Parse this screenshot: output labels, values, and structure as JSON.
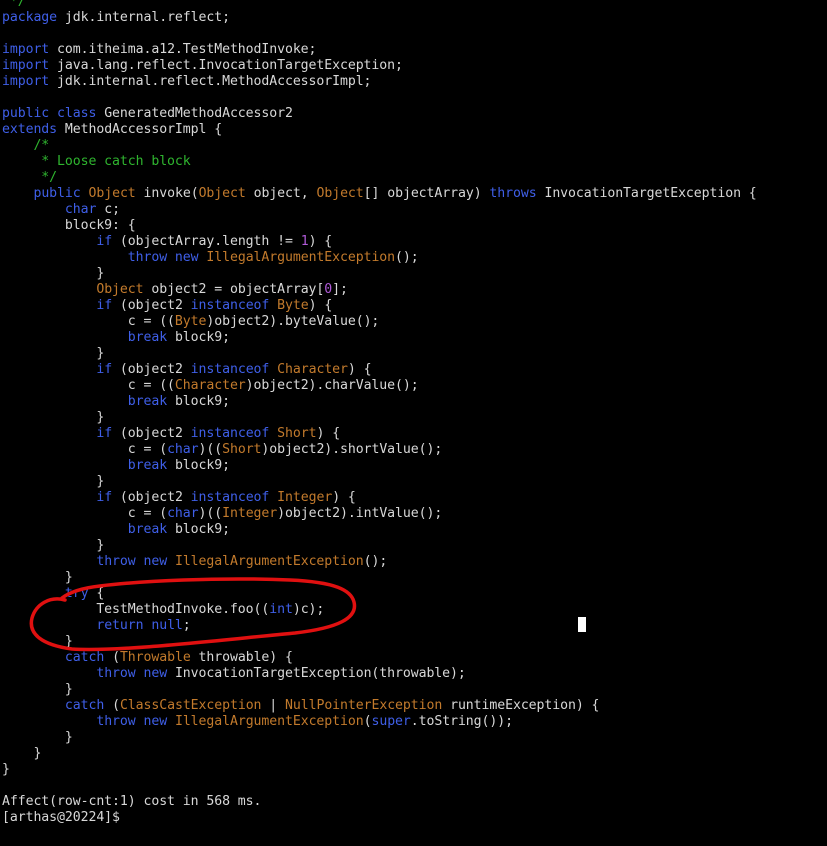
{
  "terminal": {
    "background": "#000000",
    "colors": {
      "text": "#d8d8d8",
      "keyword": "#3f5fe8",
      "type": "#c27a2c",
      "number": "#b05ad8",
      "comment": "#2fb52f",
      "annotation": "#e01010",
      "cursor": "#ffffff"
    },
    "lines": [
      [
        {
          "t": "c",
          "s": " */"
        }
      ],
      [
        {
          "t": "k",
          "s": "package"
        },
        {
          "t": "x",
          "s": " jdk.internal.reflect;"
        }
      ],
      [],
      [
        {
          "t": "k",
          "s": "import"
        },
        {
          "t": "x",
          "s": " com.itheima.a12.TestMethodInvoke;"
        }
      ],
      [
        {
          "t": "k",
          "s": "import"
        },
        {
          "t": "x",
          "s": " java.lang.reflect.InvocationTargetException;"
        }
      ],
      [
        {
          "t": "k",
          "s": "import"
        },
        {
          "t": "x",
          "s": " jdk.internal.reflect.MethodAccessorImpl;"
        }
      ],
      [],
      [
        {
          "t": "k",
          "s": "public class"
        },
        {
          "t": "x",
          "s": " GeneratedMethodAccessor2"
        }
      ],
      [
        {
          "t": "k",
          "s": "extends"
        },
        {
          "t": "x",
          "s": " MethodAccessorImpl {"
        }
      ],
      [
        {
          "t": "c",
          "s": "    /*"
        }
      ],
      [
        {
          "t": "c",
          "s": "     * Loose catch block"
        }
      ],
      [
        {
          "t": "c",
          "s": "     */"
        }
      ],
      [
        {
          "t": "x",
          "s": "    "
        },
        {
          "t": "k",
          "s": "public"
        },
        {
          "t": "x",
          "s": " "
        },
        {
          "t": "y",
          "s": "Object"
        },
        {
          "t": "x",
          "s": " invoke("
        },
        {
          "t": "y",
          "s": "Object"
        },
        {
          "t": "x",
          "s": " object, "
        },
        {
          "t": "y",
          "s": "Object"
        },
        {
          "t": "x",
          "s": "[] objectArray) "
        },
        {
          "t": "k",
          "s": "throws"
        },
        {
          "t": "x",
          "s": " InvocationTargetException {"
        }
      ],
      [
        {
          "t": "x",
          "s": "        "
        },
        {
          "t": "k",
          "s": "char"
        },
        {
          "t": "x",
          "s": " c;"
        }
      ],
      [
        {
          "t": "x",
          "s": "        block9: {"
        }
      ],
      [
        {
          "t": "x",
          "s": "            "
        },
        {
          "t": "k",
          "s": "if"
        },
        {
          "t": "x",
          "s": " (objectArray.length != "
        },
        {
          "t": "n",
          "s": "1"
        },
        {
          "t": "x",
          "s": ") {"
        }
      ],
      [
        {
          "t": "x",
          "s": "                "
        },
        {
          "t": "k",
          "s": "throw new"
        },
        {
          "t": "x",
          "s": " "
        },
        {
          "t": "y",
          "s": "IllegalArgumentException"
        },
        {
          "t": "x",
          "s": "();"
        }
      ],
      [
        {
          "t": "x",
          "s": "            }"
        }
      ],
      [
        {
          "t": "x",
          "s": "            "
        },
        {
          "t": "y",
          "s": "Object"
        },
        {
          "t": "x",
          "s": " object2 = objectArray["
        },
        {
          "t": "n",
          "s": "0"
        },
        {
          "t": "x",
          "s": "];"
        }
      ],
      [
        {
          "t": "x",
          "s": "            "
        },
        {
          "t": "k",
          "s": "if"
        },
        {
          "t": "x",
          "s": " (object2 "
        },
        {
          "t": "k",
          "s": "instanceof"
        },
        {
          "t": "x",
          "s": " "
        },
        {
          "t": "y",
          "s": "Byte"
        },
        {
          "t": "x",
          "s": ") {"
        }
      ],
      [
        {
          "t": "x",
          "s": "                c = (("
        },
        {
          "t": "y",
          "s": "Byte"
        },
        {
          "t": "x",
          "s": ")object2).byteValue();"
        }
      ],
      [
        {
          "t": "x",
          "s": "                "
        },
        {
          "t": "k",
          "s": "break"
        },
        {
          "t": "x",
          "s": " block9;"
        }
      ],
      [
        {
          "t": "x",
          "s": "            }"
        }
      ],
      [
        {
          "t": "x",
          "s": "            "
        },
        {
          "t": "k",
          "s": "if"
        },
        {
          "t": "x",
          "s": " (object2 "
        },
        {
          "t": "k",
          "s": "instanceof"
        },
        {
          "t": "x",
          "s": " "
        },
        {
          "t": "y",
          "s": "Character"
        },
        {
          "t": "x",
          "s": ") {"
        }
      ],
      [
        {
          "t": "x",
          "s": "                c = (("
        },
        {
          "t": "y",
          "s": "Character"
        },
        {
          "t": "x",
          "s": ")object2).charValue();"
        }
      ],
      [
        {
          "t": "x",
          "s": "                "
        },
        {
          "t": "k",
          "s": "break"
        },
        {
          "t": "x",
          "s": " block9;"
        }
      ],
      [
        {
          "t": "x",
          "s": "            }"
        }
      ],
      [
        {
          "t": "x",
          "s": "            "
        },
        {
          "t": "k",
          "s": "if"
        },
        {
          "t": "x",
          "s": " (object2 "
        },
        {
          "t": "k",
          "s": "instanceof"
        },
        {
          "t": "x",
          "s": " "
        },
        {
          "t": "y",
          "s": "Short"
        },
        {
          "t": "x",
          "s": ") {"
        }
      ],
      [
        {
          "t": "x",
          "s": "                c = ("
        },
        {
          "t": "k",
          "s": "char"
        },
        {
          "t": "x",
          "s": ")(("
        },
        {
          "t": "y",
          "s": "Short"
        },
        {
          "t": "x",
          "s": ")object2).shortValue();"
        }
      ],
      [
        {
          "t": "x",
          "s": "                "
        },
        {
          "t": "k",
          "s": "break"
        },
        {
          "t": "x",
          "s": " block9;"
        }
      ],
      [
        {
          "t": "x",
          "s": "            }"
        }
      ],
      [
        {
          "t": "x",
          "s": "            "
        },
        {
          "t": "k",
          "s": "if"
        },
        {
          "t": "x",
          "s": " (object2 "
        },
        {
          "t": "k",
          "s": "instanceof"
        },
        {
          "t": "x",
          "s": " "
        },
        {
          "t": "y",
          "s": "Integer"
        },
        {
          "t": "x",
          "s": ") {"
        }
      ],
      [
        {
          "t": "x",
          "s": "                c = ("
        },
        {
          "t": "k",
          "s": "char"
        },
        {
          "t": "x",
          "s": ")(("
        },
        {
          "t": "y",
          "s": "Integer"
        },
        {
          "t": "x",
          "s": ")object2).intValue();"
        }
      ],
      [
        {
          "t": "x",
          "s": "                "
        },
        {
          "t": "k",
          "s": "break"
        },
        {
          "t": "x",
          "s": " block9;"
        }
      ],
      [
        {
          "t": "x",
          "s": "            }"
        }
      ],
      [
        {
          "t": "x",
          "s": "            "
        },
        {
          "t": "k",
          "s": "throw new"
        },
        {
          "t": "x",
          "s": " "
        },
        {
          "t": "y",
          "s": "IllegalArgumentException"
        },
        {
          "t": "x",
          "s": "();"
        }
      ],
      [
        {
          "t": "x",
          "s": "        }"
        }
      ],
      [
        {
          "t": "x",
          "s": "        "
        },
        {
          "t": "k",
          "s": "try"
        },
        {
          "t": "x",
          "s": " {"
        }
      ],
      [
        {
          "t": "x",
          "s": "            TestMethodInvoke.foo(("
        },
        {
          "t": "k",
          "s": "int"
        },
        {
          "t": "x",
          "s": ")c);"
        }
      ],
      [
        {
          "t": "x",
          "s": "            "
        },
        {
          "t": "k",
          "s": "return null"
        },
        {
          "t": "x",
          "s": ";"
        }
      ],
      [
        {
          "t": "x",
          "s": "        }"
        }
      ],
      [
        {
          "t": "x",
          "s": "        "
        },
        {
          "t": "k",
          "s": "catch"
        },
        {
          "t": "x",
          "s": " ("
        },
        {
          "t": "y",
          "s": "Throwable"
        },
        {
          "t": "x",
          "s": " throwable) {"
        }
      ],
      [
        {
          "t": "x",
          "s": "            "
        },
        {
          "t": "k",
          "s": "throw new"
        },
        {
          "t": "x",
          "s": " InvocationTargetException(throwable);"
        }
      ],
      [
        {
          "t": "x",
          "s": "        }"
        }
      ],
      [
        {
          "t": "x",
          "s": "        "
        },
        {
          "t": "k",
          "s": "catch"
        },
        {
          "t": "x",
          "s": " ("
        },
        {
          "t": "y",
          "s": "ClassCastException"
        },
        {
          "t": "x",
          "s": " | "
        },
        {
          "t": "y",
          "s": "NullPointerException"
        },
        {
          "t": "x",
          "s": " runtimeException) {"
        }
      ],
      [
        {
          "t": "x",
          "s": "            "
        },
        {
          "t": "k",
          "s": "throw new"
        },
        {
          "t": "x",
          "s": " "
        },
        {
          "t": "y",
          "s": "IllegalArgumentException"
        },
        {
          "t": "x",
          "s": "("
        },
        {
          "t": "k",
          "s": "super"
        },
        {
          "t": "x",
          "s": ".toString());"
        }
      ],
      [
        {
          "t": "x",
          "s": "        }"
        }
      ],
      [
        {
          "t": "x",
          "s": "    }"
        }
      ],
      [
        {
          "t": "x",
          "s": "}"
        }
      ],
      [],
      [
        {
          "t": "x",
          "s": "Affect(row-cnt:1) cost in 568 ms."
        }
      ],
      [
        {
          "t": "x",
          "s": "[arthas@20224]$"
        }
      ]
    ]
  }
}
